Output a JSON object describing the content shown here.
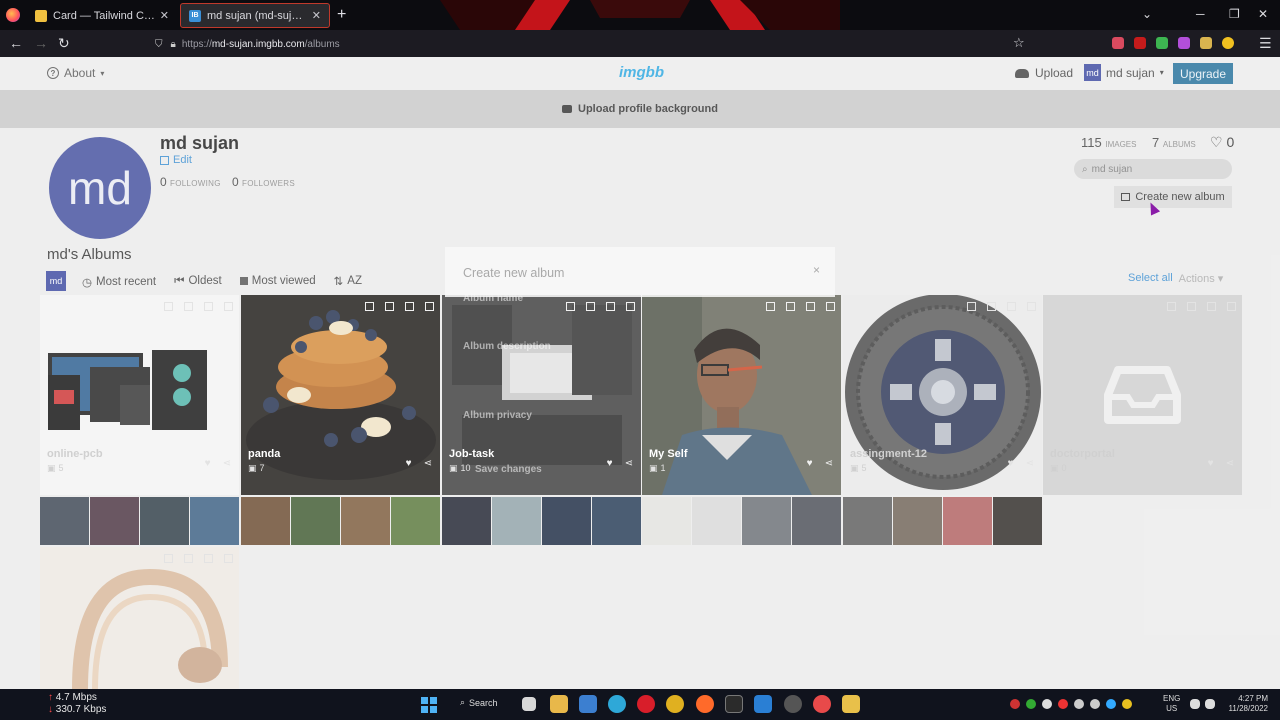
{
  "browser": {
    "tabs": [
      {
        "label": "Card — Tailwind CSS Compone",
        "favicon_color": "#f0c040"
      },
      {
        "label": "md sujan (md-sujan) — ImgBB",
        "favicon_color": "#3a8fd6"
      }
    ],
    "url_prefix": "https://",
    "url_host": "md-sujan.imgbb.com",
    "url_path": "/albums"
  },
  "site": {
    "about": "About",
    "logo": "imgbb",
    "upload": "Upload",
    "user": "md sujan",
    "user_initials": "md",
    "upgrade": "Upgrade",
    "upload_bg": "Upload profile background"
  },
  "profile": {
    "name": "md sujan",
    "initials": "md",
    "edit": "Edit",
    "following_count": "0",
    "following_label": "FOLLOWING",
    "followers_count": "0",
    "followers_label": "FOLLOWERS",
    "images_count": "115",
    "images_label": "IMAGES",
    "albums_count": "7",
    "albums_label": "ALBUMS",
    "likes_count": "0",
    "search_placeholder": "md sujan",
    "create_album": "Create new album"
  },
  "albums_section": {
    "title": "md's Albums",
    "badge": "md",
    "tabs": [
      "Most recent",
      "Oldest",
      "Most viewed",
      "AZ"
    ],
    "select_all": "Select all",
    "actions": "Actions"
  },
  "albums": [
    {
      "title": "online-pcb",
      "count": "5"
    },
    {
      "title": "panda",
      "count": "7"
    },
    {
      "title": "Job-task",
      "count": "10"
    },
    {
      "title": "My Self",
      "count": "1"
    },
    {
      "title": "assingment-12",
      "count": "5"
    },
    {
      "title": "doctorportal",
      "count": "0"
    }
  ],
  "modal": {
    "title": "Create new album",
    "close": "×",
    "ghost_album_name": "Album name",
    "ghost_album_description": "Album description",
    "ghost_album_privacy": "Album privacy",
    "ghost_save": "Save changes"
  },
  "taskbar": {
    "net_up": "4.7 Mbps",
    "net_down": "330.7 Kbps",
    "search": "Search",
    "lang_1": "ENG",
    "lang_2": "US",
    "time": "4:27 PM",
    "date": "11/28/2022"
  }
}
